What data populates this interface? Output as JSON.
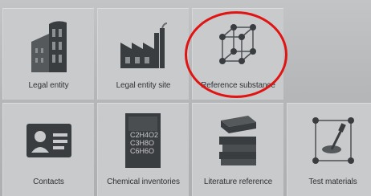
{
  "tiles": [
    {
      "label": "Legal entity",
      "icon": "building-icon"
    },
    {
      "label": "Legal entity site",
      "icon": "factory-icon"
    },
    {
      "label": "Reference substance",
      "icon": "crystal-lattice-icon"
    },
    {
      "label": "Contacts",
      "icon": "contact-card-icon"
    },
    {
      "label": "Chemical inventories",
      "icon": "chemical-inventory-icon"
    },
    {
      "label": "Literature reference",
      "icon": "books-icon"
    },
    {
      "label": "Test materials",
      "icon": "test-materials-icon"
    }
  ],
  "inventory_formulas": [
    "C2H4O2",
    "C3H8O",
    "C6H6O"
  ],
  "highlight": {
    "target": "Reference substance",
    "color": "#e11414"
  }
}
